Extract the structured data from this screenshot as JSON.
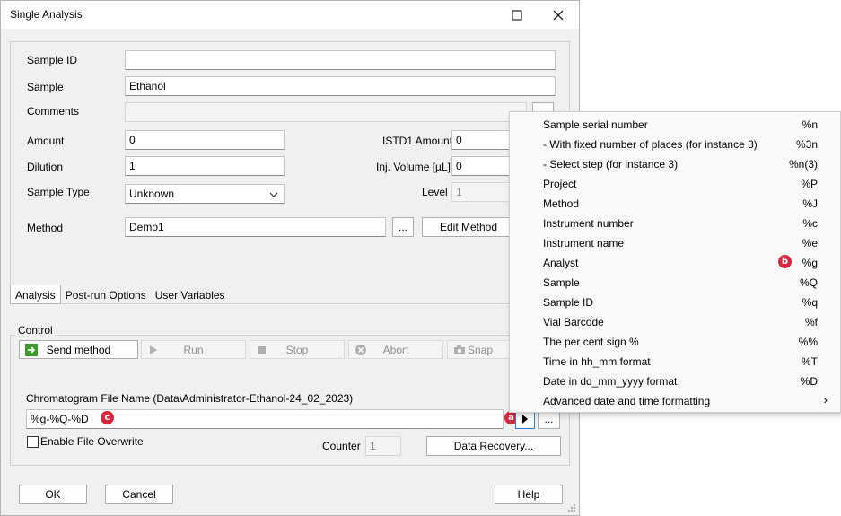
{
  "window": {
    "title": "Single Analysis"
  },
  "form": {
    "sample_id_label": "Sample ID",
    "sample_id_value": "",
    "sample_label": "Sample",
    "sample_value": "Ethanol",
    "comments_label": "Comments",
    "amount_label": "Amount",
    "amount_value": "0",
    "istd_label": "ISTD1 Amount",
    "istd_value": "0",
    "dilution_label": "Dilution",
    "dilution_value": "1",
    "injvol_label": "Inj. Volume [µL]",
    "injvol_value": "0",
    "sampletype_label": "Sample Type",
    "sampletype_value": "Unknown",
    "level_label": "Level",
    "level_value": "1",
    "method_label": "Method",
    "method_value": "Demo1",
    "browse_label": "...",
    "edit_method_label": "Edit Method"
  },
  "tabs": [
    "Analysis",
    "Post-run Options",
    "User Variables"
  ],
  "control": {
    "group_label": "Control",
    "send_method": "Send method",
    "run": "Run",
    "stop": "Stop",
    "abort": "Abort",
    "snap": "Snap",
    "chrom_label": "Chromatogram File Name (Data\\Administrator-Ethanol-24_02_2023)",
    "chrom_value": "%g-%Q-%D",
    "more_label": "...",
    "overwrite_label": "Enable File Overwrite",
    "counter_label": "Counter",
    "counter_value": "1",
    "data_recovery": "Data Recovery..."
  },
  "footer": {
    "ok": "OK",
    "cancel": "Cancel",
    "help": "Help"
  },
  "markers": {
    "a": "a",
    "b": "b",
    "c": "c"
  },
  "menu": {
    "items": [
      {
        "label": "Sample serial number",
        "shortcut": "%n"
      },
      {
        "label": " - With fixed number of places (for instance 3)",
        "shortcut": "%3n"
      },
      {
        "label": " - Select step (for instance 3)",
        "shortcut": "%n(3)"
      },
      {
        "label": "Project",
        "shortcut": "%P"
      },
      {
        "label": "Method",
        "shortcut": "%J"
      },
      {
        "label": "Instrument number",
        "shortcut": "%c"
      },
      {
        "label": "Instrument name",
        "shortcut": "%e"
      },
      {
        "label": "Analyst",
        "shortcut": "%g"
      },
      {
        "label": "Sample",
        "shortcut": "%Q"
      },
      {
        "label": "Sample ID",
        "shortcut": "%q"
      },
      {
        "label": "Vial Barcode",
        "shortcut": "%f"
      },
      {
        "label": "The per cent sign %",
        "shortcut": "%%"
      },
      {
        "label": "Time in hh_mm format",
        "shortcut": "%T"
      },
      {
        "label": "Date in dd_mm_yyyy format",
        "shortcut": "%D"
      },
      {
        "label": "Advanced date and time formatting",
        "shortcut": ""
      }
    ]
  },
  "colors": {
    "marker": "#d7263d",
    "send_icon": "#3a9a2a"
  }
}
